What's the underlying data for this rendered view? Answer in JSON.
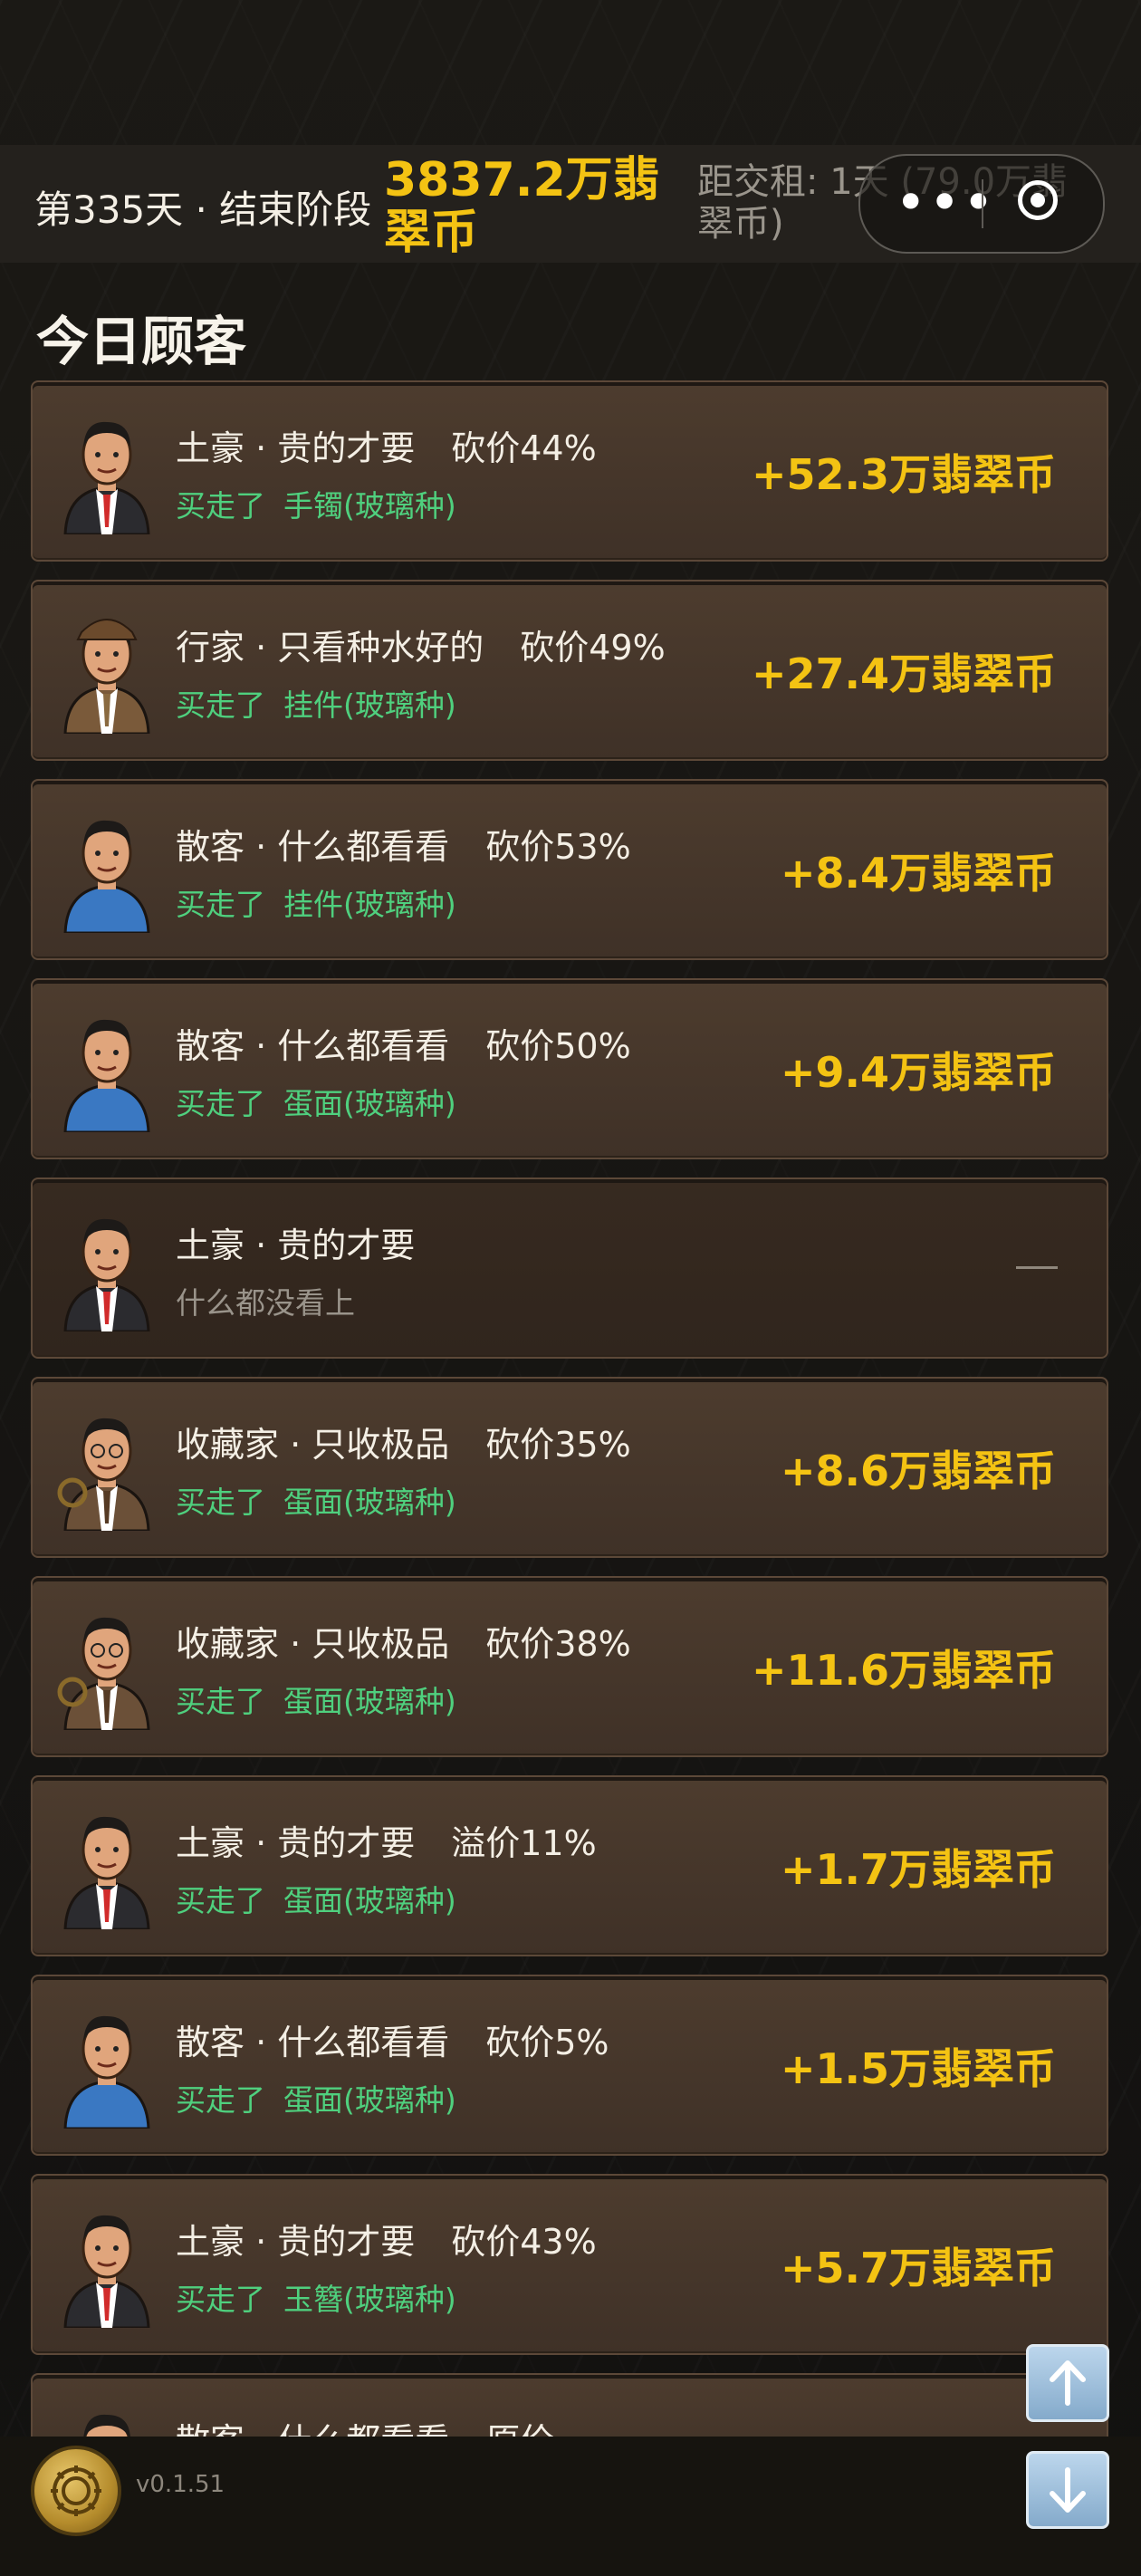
{
  "header": {
    "day_label": "第335天 · 结束阶段",
    "money_text": "3837.2万翡翠币",
    "rent_text": "距交租: 1天 (79.0万翡翠币)"
  },
  "section_title": "今日顾客",
  "customers": [
    {
      "type": "土豪 · 贵的才要",
      "bargain": "砍价44%",
      "status": "买走了",
      "item": "手镯(玻璃种)",
      "gain": "+52.3万翡翠币",
      "avatar": "tycoon-avatar-icon"
    },
    {
      "type": "行家 · 只看种水好的",
      "bargain": "砍价49%",
      "status": "买走了",
      "item": "挂件(玻璃种)",
      "gain": "+27.4万翡翠币",
      "avatar": "expert-avatar-icon"
    },
    {
      "type": "散客 · 什么都看看",
      "bargain": "砍价53%",
      "status": "买走了",
      "item": "挂件(玻璃种)",
      "gain": "+8.4万翡翠币",
      "avatar": "casual-avatar-icon"
    },
    {
      "type": "散客 · 什么都看看",
      "bargain": "砍价50%",
      "status": "买走了",
      "item": "蛋面(玻璃种)",
      "gain": "+9.4万翡翠币",
      "avatar": "casual-avatar-icon"
    },
    {
      "type": "土豪 · 贵的才要",
      "bargain": "",
      "status": "什么都没看上",
      "item": "",
      "gain": "",
      "avatar": "tycoon-avatar-icon"
    },
    {
      "type": "收藏家 · 只收极品",
      "bargain": "砍价35%",
      "status": "买走了",
      "item": "蛋面(玻璃种)",
      "gain": "+8.6万翡翠币",
      "avatar": "collector-avatar-icon"
    },
    {
      "type": "收藏家 · 只收极品",
      "bargain": "砍价38%",
      "status": "买走了",
      "item": "蛋面(玻璃种)",
      "gain": "+11.6万翡翠币",
      "avatar": "collector-avatar-icon"
    },
    {
      "type": "土豪 · 贵的才要",
      "bargain": "溢价11%",
      "status": "买走了",
      "item": "蛋面(玻璃种)",
      "gain": "+1.7万翡翠币",
      "avatar": "tycoon-avatar-icon"
    },
    {
      "type": "散客 · 什么都看看",
      "bargain": "砍价5%",
      "status": "买走了",
      "item": "蛋面(玻璃种)",
      "gain": "+1.5万翡翠币",
      "avatar": "casual-avatar-icon"
    },
    {
      "type": "土豪 · 贵的才要",
      "bargain": "砍价43%",
      "status": "买走了",
      "item": "玉簪(玻璃种)",
      "gain": "+5.7万翡翠币",
      "avatar": "tycoon-avatar-icon"
    },
    {
      "type": "散客 · 什么都看看",
      "bargain": "原价",
      "status": "",
      "item": "",
      "gain": "",
      "avatar": "casual-avatar-icon"
    }
  ],
  "footer": {
    "version": "v0.1.51"
  },
  "colors": {
    "gold": "#f4c313",
    "green": "#4fd07e",
    "card": "#4d3c2e"
  }
}
